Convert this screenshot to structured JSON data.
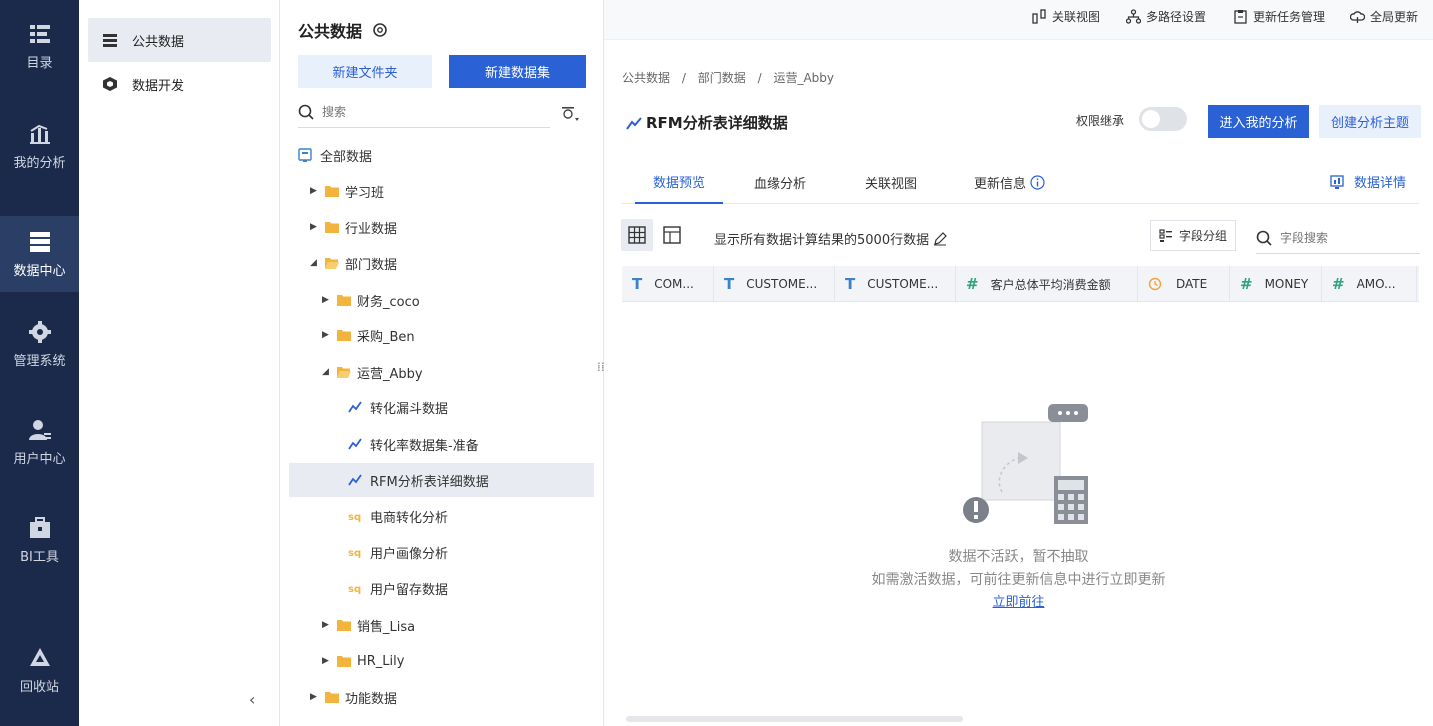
{
  "nav": {
    "items": [
      {
        "label": "目录",
        "icon": "catalog-icon"
      },
      {
        "label": "我的分析",
        "icon": "analysis-icon"
      },
      {
        "label": "数据中心",
        "icon": "data-center-icon"
      },
      {
        "label": "管理系统",
        "icon": "gear-icon"
      },
      {
        "label": "用户中心",
        "icon": "user-icon"
      },
      {
        "label": "BI工具",
        "icon": "toolbox-icon"
      },
      {
        "label": "回收站",
        "icon": "recycle-icon"
      }
    ]
  },
  "subnav": {
    "items": [
      {
        "label": "公共数据"
      },
      {
        "label": "数据开发"
      }
    ]
  },
  "tree": {
    "title": "公共数据",
    "new_folder": "新建文件夹",
    "new_dataset": "新建数据集",
    "search_placeholder": "搜索",
    "nodes": [
      {
        "label": "全部数据"
      },
      {
        "label": "学习班"
      },
      {
        "label": "行业数据"
      },
      {
        "label": "部门数据"
      },
      {
        "label": "财务_coco"
      },
      {
        "label": "采购_Ben"
      },
      {
        "label": "运营_Abby"
      },
      {
        "label": "转化漏斗数据"
      },
      {
        "label": "转化率数据集-准备"
      },
      {
        "label": "RFM分析表详细数据"
      },
      {
        "label": "电商转化分析"
      },
      {
        "label": "用户画像分析"
      },
      {
        "label": "用户留存数据"
      },
      {
        "label": "销售_Lisa"
      },
      {
        "label": "HR_Lily"
      },
      {
        "label": "功能数据"
      }
    ]
  },
  "topbar": {
    "lineage": "关联视图",
    "multipath": "多路径设置",
    "tasks": "更新任务管理",
    "global_update": "全局更新"
  },
  "main": {
    "breadcrumb": [
      "公共数据",
      "部门数据",
      "运营_Abby"
    ],
    "breadcrumb_sep": "/",
    "title": "RFM分析表详细数据",
    "perm_label": "权限继承",
    "enter_btn": "进入我的分析",
    "create_btn": "创建分析主题",
    "tabs": [
      "数据预览",
      "血缘分析",
      "关联视图",
      "更新信息"
    ],
    "detail_link": "数据详情",
    "hint": "显示所有数据计算结果的5000行数据",
    "group_btn": "字段分组",
    "field_search_placeholder": "字段搜索",
    "columns": [
      {
        "type": "T",
        "name": "COM..."
      },
      {
        "type": "T",
        "name": "CUSTOME..."
      },
      {
        "type": "T",
        "name": "CUSTOME..."
      },
      {
        "type": "#",
        "name": "客户总体平均消费金额"
      },
      {
        "type": "date",
        "name": "DATE"
      },
      {
        "type": "#",
        "name": "MONEY"
      },
      {
        "type": "#",
        "name": "AMO..."
      }
    ],
    "empty_line1": "数据不活跃，暂不抽取",
    "empty_line2": "如需激活数据，可前往更新信息中进行立即更新",
    "empty_link": "立即前往"
  },
  "colors": {
    "nav_bg": "#1b2a4b",
    "nav_active": "#2b3f66",
    "primary": "#2a62d6",
    "folder": "#f2b43c"
  }
}
